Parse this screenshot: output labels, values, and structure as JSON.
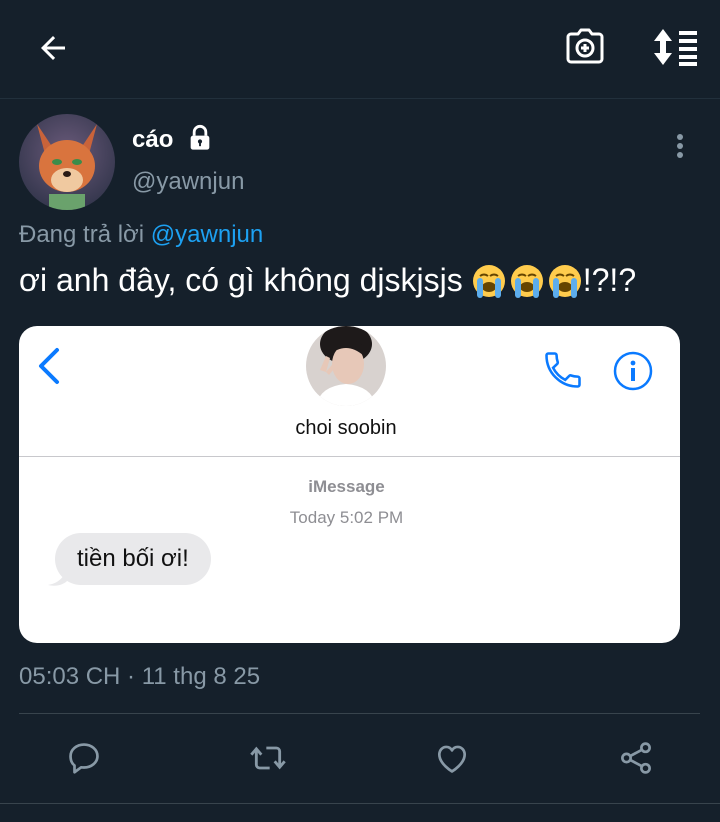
{
  "header": {
    "back_icon": "arrow-left-icon",
    "camera_icon": "camera-plus-icon",
    "sort_icon": "sort-list-icon"
  },
  "tweet": {
    "author_name": "cáo",
    "author_handle": "@yawnjun",
    "locked_icon": "lock-icon",
    "reply_prefix": "Đang trả lời",
    "reply_to": "@yawnjun",
    "text": "ơi anh đây, có gì không djskjsjs",
    "text_suffix": "!?!?",
    "emojis": [
      "loudly-crying-face",
      "loudly-crying-face",
      "loudly-crying-face"
    ],
    "timestamp": "05:03 CH · 11 thg 8 25"
  },
  "media": {
    "contact_name": "choi soobin",
    "service": "iMessage",
    "time": "Today 5:02 PM",
    "message": "tiền bối ơi!"
  },
  "actions": [
    "reply-icon",
    "retweet-icon",
    "like-icon",
    "share-icon"
  ],
  "colors": {
    "background": "#15202b",
    "accent": "#1da1f2",
    "muted": "#8899a6",
    "ios_blue": "#0a7aff"
  }
}
